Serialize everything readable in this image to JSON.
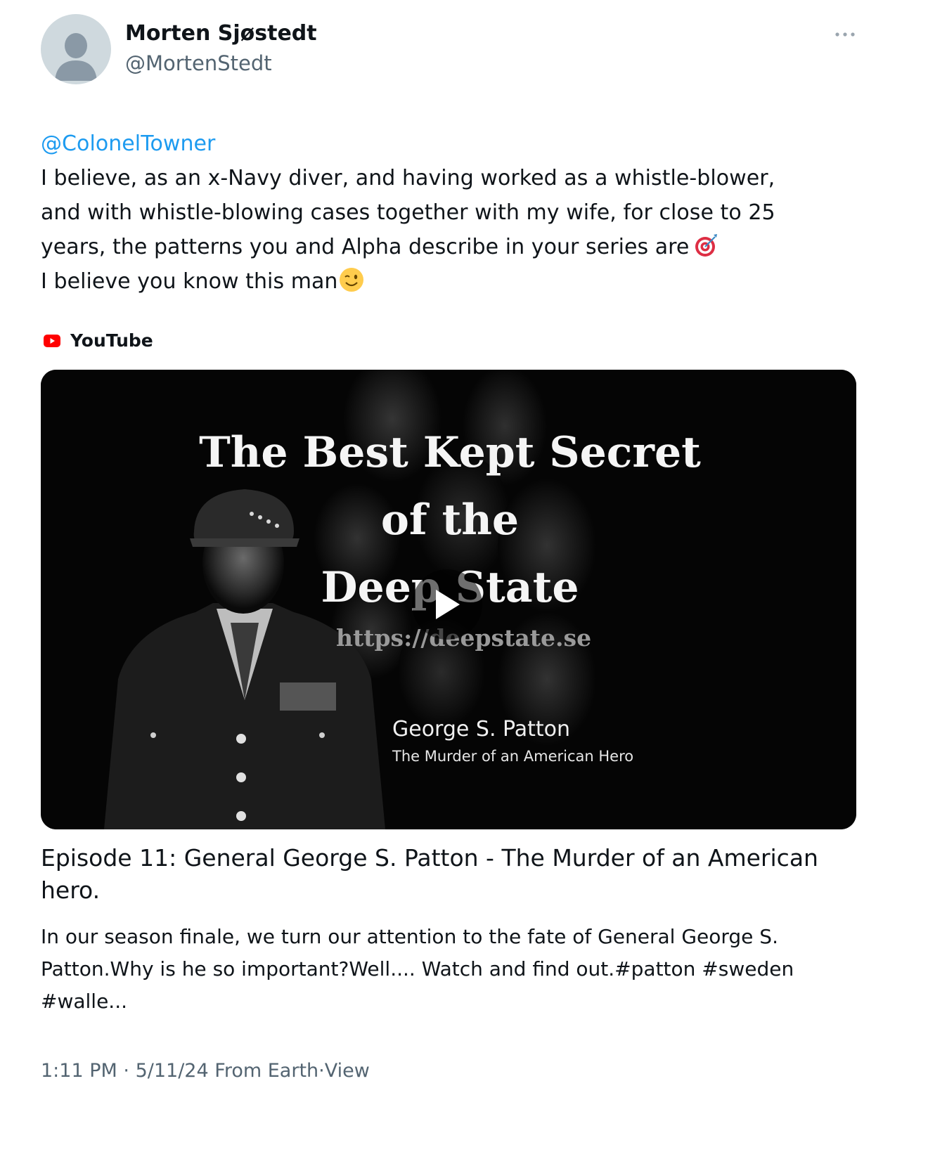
{
  "author": {
    "display_name": "Morten Sjøstedt",
    "handle": "@MortenStedt",
    "avatar_icon": "default-avatar-icon"
  },
  "more_icon": "more-horizontal-icon",
  "tweet": {
    "mention": "@ColonelTowner",
    "line1": "I believe, as an x-Navy diver, and having worked as a whistle-blower,",
    "line2": "and with whistle-blowing cases together with my wife, for close to 25",
    "line3": "years, the patterns you and Alpha describe in your series are",
    "line3_emoji": "direct-hit-emoji",
    "line4": "I believe you know this man",
    "line4_emoji": "winking-face-emoji"
  },
  "link_card": {
    "source_label": "YouTube",
    "source_icon": "youtube-icon",
    "thumbnail": {
      "title_line1": "The Best Kept Secret",
      "title_line2": "of the",
      "title_line3": "Deep State",
      "url": "https://deepstate.se",
      "name": "George S. Patton",
      "subtitle": "The Murder of an American Hero"
    },
    "title_line1": "Episode 11: General George S. Patton - The Murder of an American",
    "title_line2": "hero.",
    "desc_line1": "In our season finale, we turn our attention to the fate of General George S.",
    "desc_line2": "Patton.Why is he so important?Well.... Watch and find out.#patton #sweden",
    "desc_line3": "#walle..."
  },
  "meta": {
    "time": "1:11 PM",
    "date": "5/11/24",
    "source": "From Earth",
    "view": "View",
    "separator": "·"
  },
  "colors": {
    "link": "#1d9bf0",
    "secondary_text": "#536471",
    "youtube_red": "#ff0000"
  }
}
